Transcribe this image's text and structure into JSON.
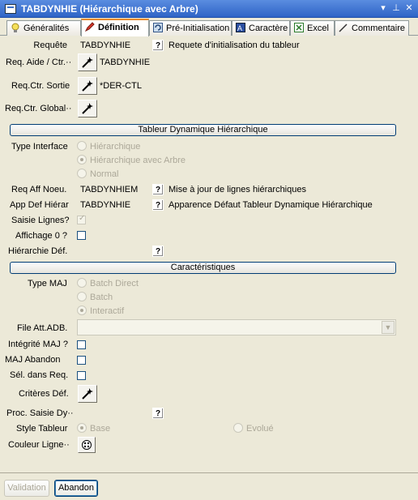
{
  "window": {
    "title": "TABDYNHIE (Hiérarchique avec Arbre)"
  },
  "tabs": [
    {
      "label": "Généralités"
    },
    {
      "label": "Définition"
    },
    {
      "label": "Pré-Initialisation"
    },
    {
      "label": "Caractère"
    },
    {
      "label": "Excel"
    },
    {
      "label": "Commentaire"
    }
  ],
  "form": {
    "requete": {
      "label": "Requête",
      "value": "TABDYNHIE",
      "desc": "Requete d'initialisation du tableur"
    },
    "req_aide": {
      "label": "Req. Aide / Ctr.··",
      "value": "TABDYNHIE"
    },
    "req_ctr_sortie": {
      "label": "Req.Ctr. Sortie",
      "value": "*DER-CTL"
    },
    "req_ctr_global": {
      "label": "Req.Ctr. Global··"
    },
    "section1": "Tableur Dynamique Hiérarchique",
    "type_interface": {
      "label": "Type Interface",
      "options": [
        "Hiérarchique",
        "Hiérarchique avec Arbre",
        "Normal"
      ],
      "selected": "Hiérarchique avec Arbre"
    },
    "req_aff_noeu": {
      "label": "Req Aff Noeu.",
      "value": "TABDYNHIEM",
      "desc": "Mise à jour de lignes hiérarchiques"
    },
    "app_def_hierar": {
      "label": "App Def Hiérar",
      "value": "TABDYNHIE",
      "desc": "Apparence Défaut Tableur Dynamique Hiérarchique"
    },
    "saisie_lignes": {
      "label": "Saisie Lignes?",
      "checked": true
    },
    "affichage_0": {
      "label": "Affichage 0 ?",
      "checked": false
    },
    "hierarchie_def": {
      "label": "Hiérarchie Déf."
    },
    "section2": "Caractéristiques",
    "type_maj": {
      "label": "Type MAJ",
      "options": [
        "Batch Direct",
        "Batch",
        "Interactif"
      ],
      "selected": "Interactif"
    },
    "file_att_adb": {
      "label": "File Att.ADB.",
      "value": ""
    },
    "integrite_maj": {
      "label": "Intégrité MAJ ?",
      "checked": false
    },
    "maj_abandon": {
      "label": "MAJ Abandon",
      "checked": false
    },
    "sel_dans_req": {
      "label": "Sél. dans Req.",
      "checked": false
    },
    "criteres_def": {
      "label": "Critères Déf."
    },
    "proc_saisie": {
      "label": "Proc. Saisie Dy··"
    },
    "style_tableur": {
      "label": "Style Tableur",
      "options": [
        "Base",
        "Evolué"
      ],
      "selected": "Base"
    },
    "couleur_ligne": {
      "label": "Couleur Ligne··"
    }
  },
  "buttons": {
    "validation": "Validation",
    "abandon": "Abandon"
  }
}
